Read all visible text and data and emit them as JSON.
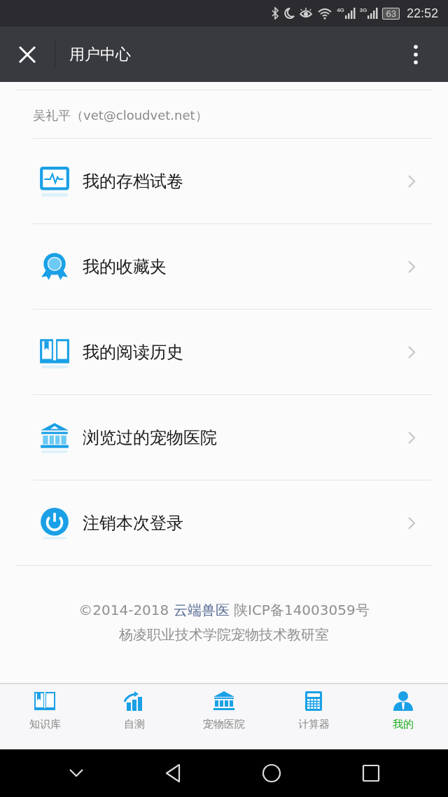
{
  "status_bar": {
    "network_1": "4G",
    "network_2": "3G",
    "battery": "63",
    "time": "22:52"
  },
  "header": {
    "title": "用户中心"
  },
  "user": {
    "label": "吴礼平（vet@cloudvet.net）"
  },
  "menu": [
    {
      "label": "我的存档试卷"
    },
    {
      "label": "我的收藏夹"
    },
    {
      "label": "我的阅读历史"
    },
    {
      "label": "浏览过的宠物医院"
    },
    {
      "label": "注销本次登录"
    }
  ],
  "footer": {
    "prefix": "©2014-2018",
    "link": "云端兽医",
    "suffix": "陕ICP备14003059号",
    "line_2": "杨凌职业技术学院宠物技术教研室"
  },
  "tabs": [
    {
      "label": "知识库",
      "selected": false
    },
    {
      "label": "自测",
      "selected": false
    },
    {
      "label": "宠物医院",
      "selected": false
    },
    {
      "label": "计算器",
      "selected": false
    },
    {
      "label": "我的",
      "selected": true
    }
  ]
}
